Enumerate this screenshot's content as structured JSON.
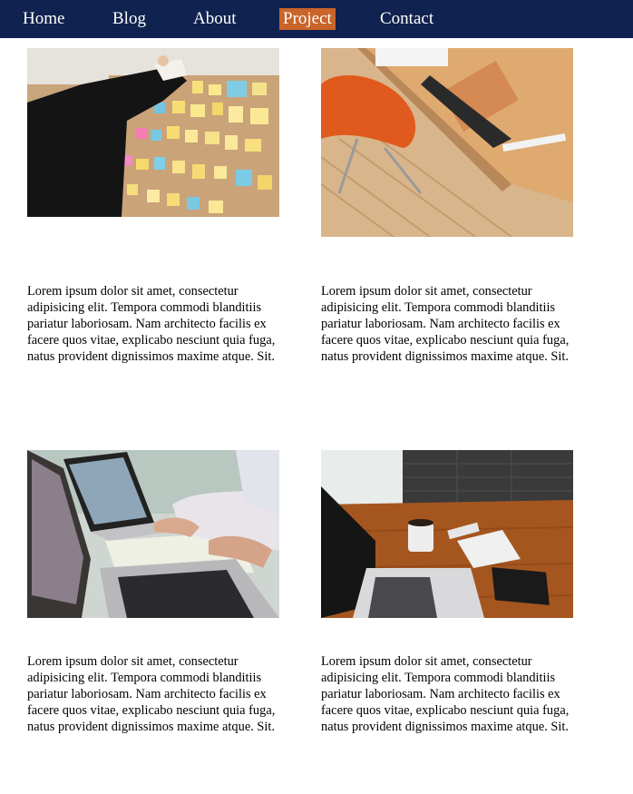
{
  "nav": {
    "items": [
      {
        "label": "Home",
        "active": false
      },
      {
        "label": "Blog",
        "active": false
      },
      {
        "label": "About",
        "active": false
      },
      {
        "label": "Project",
        "active": true
      },
      {
        "label": "Contact",
        "active": false
      }
    ]
  },
  "cards": [
    {
      "image": "sticky-notes-planning-board-photo",
      "text": "Lorem ipsum dolor sit amet, consectetur adipisicing elit. Tempora commodi blanditiis pariatur laboriosam. Nam architecto facilis ex facere quos vitae, explicabo nesciunt quia fuga, natus provident dignissimos maxime atque. Sit."
    },
    {
      "image": "wooden-desk-orange-chair-photo",
      "text": "Lorem ipsum dolor sit amet, consectetur adipisicing elit. Tempora commodi blanditiis pariatur laboriosam. Nam architecto facilis ex facere quos vitae, explicabo nesciunt quia fuga, natus provident dignissimos maxime atque. Sit."
    },
    {
      "image": "laptops-meeting-notes-photo",
      "text": "Lorem ipsum dolor sit amet, consectetur adipisicing elit. Tempora commodi blanditiis pariatur laboriosam. Nam architecto facilis ex facere quos vitae, explicabo nesciunt quia fuga, natus provident dignissimos maxime atque. Sit."
    },
    {
      "image": "laptop-coffee-desk-photo",
      "text": "Lorem ipsum dolor sit amet, consectetur adipisicing elit. Tempora commodi blanditiis pariatur laboriosam. Nam architecto facilis ex facere quos vitae, explicabo nesciunt quia fuga, natus provident dignissimos maxime atque. Sit."
    }
  ],
  "colors": {
    "nav_bg": "#10224f",
    "active_bg": "#c9642a",
    "nav_text": "#ffffff"
  }
}
